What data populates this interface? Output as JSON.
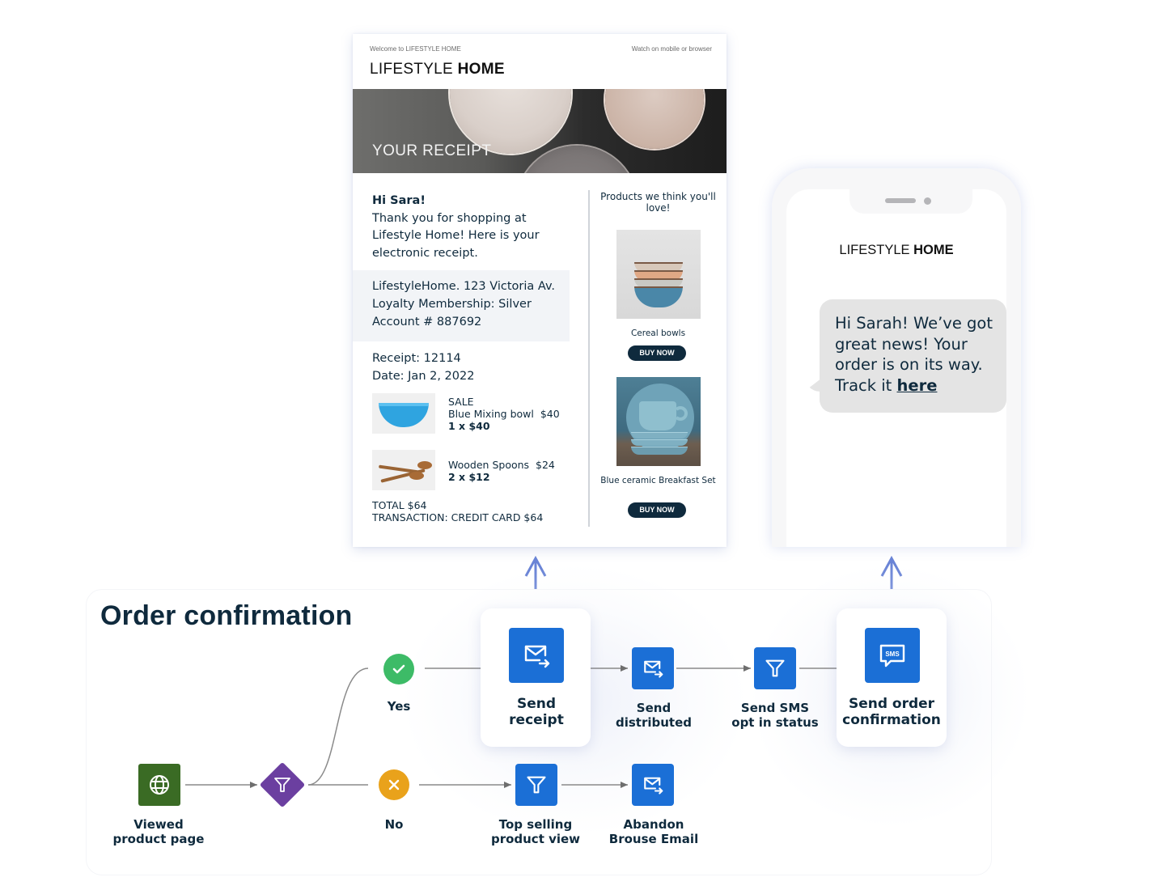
{
  "email": {
    "preheader_left": "Welcome to LIFESTYLE HOME",
    "preheader_right": "Watch on mobile or browser",
    "brand_light": "LIFESTYLE ",
    "brand_bold": "HOME",
    "hero_title": "YOUR RECEIPT",
    "greeting": "Hi Sara!",
    "intro": "Thank you for shopping at Lifestyle Home! Here is your electronic receipt.",
    "account_lines": [
      "LifestyleHome. 123 Victoria Av.",
      "Loyalty Membership: Silver",
      "Account # 887692"
    ],
    "receipt_line": "Receipt: 12114",
    "date_line": "Date: Jan 2, 2022",
    "items": [
      {
        "tag": "SALE",
        "name_price": "Blue Mixing bowl  $40",
        "qty": "1 x $40",
        "image": "blue-bowl-image"
      },
      {
        "tag": "",
        "name_price": "Wooden Spoons  $24",
        "qty": "2 x $12",
        "image": "wooden-spoons-image"
      }
    ],
    "total": "TOTAL $64",
    "transaction": "TRANSACTION: CREDIT CARD  $64",
    "recommend_title": "Products we think you'll love!",
    "products": [
      {
        "name": "Cereal bowls",
        "button": "BUY NOW"
      },
      {
        "name": "Blue ceramic Breakfast Set",
        "button": "BUY NOW"
      }
    ]
  },
  "phone": {
    "brand_light": "LIFESTYLE ",
    "brand_bold": "HOME",
    "sms_text": "Hi Sarah! We’ve got great news! Your order is on its way. Track it ",
    "sms_link": "here"
  },
  "flow": {
    "title": "Order confirmation",
    "nodes": [
      {
        "id": "viewed",
        "label": "Viewed\nproduct page",
        "icon": "globe-icon",
        "color": "#3a6b24"
      },
      {
        "id": "split",
        "label": "",
        "icon": "filter-icon",
        "color": "#6b3fa0"
      },
      {
        "id": "yes",
        "label": "Yes",
        "icon": "check-icon",
        "color": "#3dbb67"
      },
      {
        "id": "no",
        "label": "No",
        "icon": "close-icon",
        "color": "#e9a21b"
      },
      {
        "id": "send_receipt",
        "label": "Send\nreceipt",
        "icon": "email-send-icon",
        "color": "#1b6fd6"
      },
      {
        "id": "send_distributed",
        "label": "Send\ndistributed",
        "icon": "email-send-icon",
        "color": "#1b6fd6"
      },
      {
        "id": "sms_optin",
        "label": "Send SMS\nopt in status",
        "icon": "filter-icon",
        "color": "#1b6fd6"
      },
      {
        "id": "send_order_conf",
        "label": "Send order\nconfirmation",
        "icon": "sms-icon",
        "color": "#1b6fd6"
      },
      {
        "id": "top_selling",
        "label": "Top selling\nproduct view",
        "icon": "filter-icon",
        "color": "#1b6fd6"
      },
      {
        "id": "abandon",
        "label": "Abandon\nBrouse Email",
        "icon": "email-send-icon",
        "color": "#1b6fd6"
      }
    ],
    "sms_badge": "SMS",
    "arrow_color": "#6a84d6"
  }
}
